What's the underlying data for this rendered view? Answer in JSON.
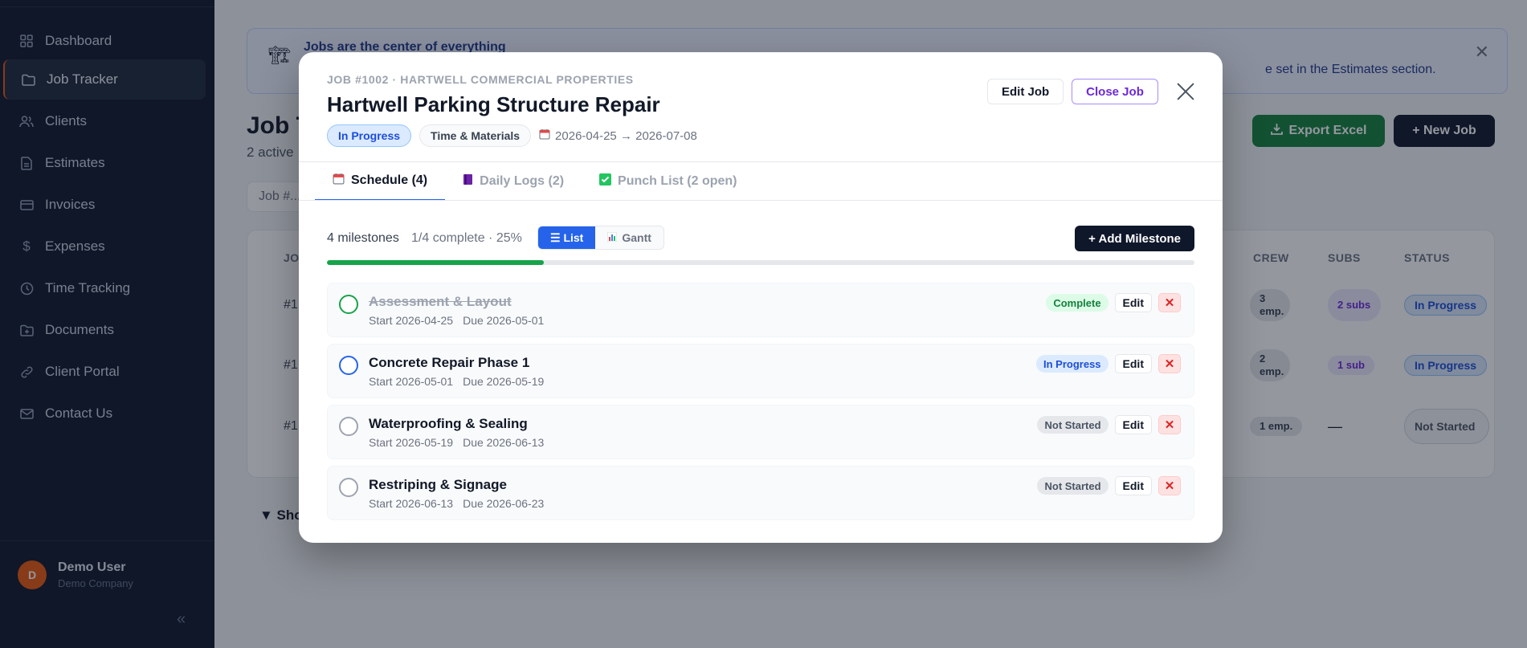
{
  "sidebar": {
    "items": [
      {
        "label": "Dashboard",
        "icon": "grid-icon"
      },
      {
        "label": "Job Tracker",
        "icon": "folder-icon",
        "active": true
      },
      {
        "label": "Clients",
        "icon": "users-icon"
      },
      {
        "label": "Estimates",
        "icon": "file-icon"
      },
      {
        "label": "Invoices",
        "icon": "card-icon"
      },
      {
        "label": "Expenses",
        "icon": "dollar-icon"
      },
      {
        "label": "Time Tracking",
        "icon": "clock-icon"
      },
      {
        "label": "Documents",
        "icon": "folder-plus-icon"
      },
      {
        "label": "Client Portal",
        "icon": "link-icon"
      },
      {
        "label": "Contact Us",
        "icon": "mail-icon"
      }
    ],
    "user": {
      "initial": "D",
      "name": "Demo User",
      "company": "Demo Company"
    },
    "collapse_glyph": "«"
  },
  "background": {
    "banner_title": "Jobs are the center of everything",
    "banner_text": "e set in the Estimates section.",
    "page_title": "Job T",
    "page_sub": "2 active",
    "export_label": "Export Excel",
    "new_job_label": "+ New Job",
    "search_placeholder": "Job #...",
    "columns": {
      "id": "JO",
      "crew": "CREW",
      "subs": "SUBS",
      "status": "STATUS"
    },
    "rows": [
      {
        "id": "#1",
        "crew": "3 emp.",
        "subs": "2 subs",
        "status": "In Progress"
      },
      {
        "id": "#1",
        "crew": "2 emp.",
        "subs": "1 sub",
        "status": "In Progress"
      },
      {
        "id": "#1",
        "crew": "1 emp.",
        "subs": "—",
        "status": "Not Started"
      }
    ],
    "show_more": "▼ Sho"
  },
  "modal": {
    "crumb": "JOB #1002 · HARTWELL COMMERCIAL PROPERTIES",
    "title": "Hartwell Parking Structure Repair",
    "status_badge": "In Progress",
    "billing_badge": "Time & Materials",
    "date_range": "2026-04-25 → 2026-07-08",
    "edit_job_label": "Edit Job",
    "close_job_label": "Close Job",
    "tabs": [
      {
        "label": "Schedule (4)",
        "icon": "calendar-icon",
        "active": true
      },
      {
        "label": "Daily Logs (2)",
        "icon": "notebook-icon"
      },
      {
        "label": "Punch List (2 open)",
        "icon": "checkbox-icon"
      }
    ],
    "toolbar": {
      "count": "4 milestones",
      "progress_text": "1/4 complete · 25%",
      "progress": 0.25,
      "list_label": "☰ List",
      "gantt_label": "Gantt",
      "add_label": "+ Add Milestone"
    },
    "milestones": [
      {
        "name": "Assessment & Layout",
        "start": "Start 2026-04-25",
        "due": "Due 2026-05-01",
        "status": "Complete",
        "edit": "Edit"
      },
      {
        "name": "Concrete Repair Phase 1",
        "start": "Start 2026-05-01",
        "due": "Due 2026-05-19",
        "status": "In Progress",
        "edit": "Edit"
      },
      {
        "name": "Waterproofing & Sealing",
        "start": "Start 2026-05-19",
        "due": "Due 2026-06-13",
        "status": "Not Started",
        "edit": "Edit"
      },
      {
        "name": "Restriping & Signage",
        "start": "Start 2026-06-13",
        "due": "Due 2026-06-23",
        "status": "Not Started",
        "edit": "Edit"
      }
    ]
  },
  "colors": {
    "accent": "#2563eb",
    "brand_dark": "#0f172a",
    "success": "#16a34a",
    "danger": "#dc2626"
  }
}
